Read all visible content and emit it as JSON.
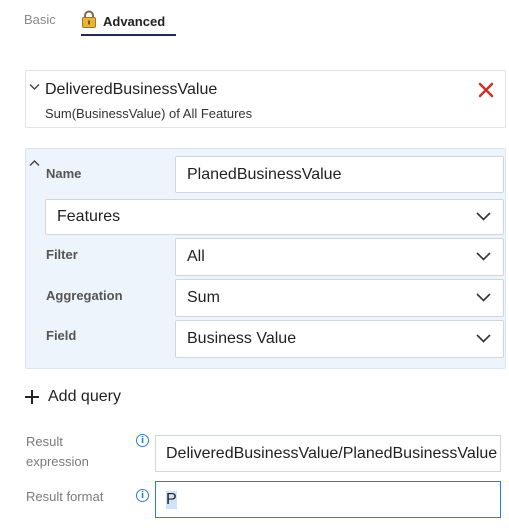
{
  "tabs": {
    "basic": "Basic",
    "advanced": "Advanced"
  },
  "collapsed_query": {
    "title": "DeliveredBusinessValue",
    "subtitle": "Sum(BusinessValue) of All Features"
  },
  "expanded_query": {
    "name_label": "Name",
    "name_value": "PlanedBusinessValue",
    "work_item_type": "Features",
    "filter_label": "Filter",
    "filter_value": "All",
    "aggregation_label": "Aggregation",
    "aggregation_value": "Sum",
    "field_label": "Field",
    "field_value": "Business Value"
  },
  "add_query_label": "Add query",
  "result_expression": {
    "label_line1": "Result",
    "label_line2": "expression",
    "value": "DeliveredBusinessValue/PlanedBusinessValue"
  },
  "result_format": {
    "label": "Result format",
    "value": "P"
  },
  "colors": {
    "accent": "#2a7fd4",
    "close_red": "#c8362b",
    "tab_underline": "#1d2a56",
    "expanded_bg": "#eef4fb"
  },
  "icons": [
    "lock-icon",
    "chevron-down-icon",
    "chevron-up-icon",
    "close-icon",
    "plus-icon",
    "info-icon"
  ]
}
